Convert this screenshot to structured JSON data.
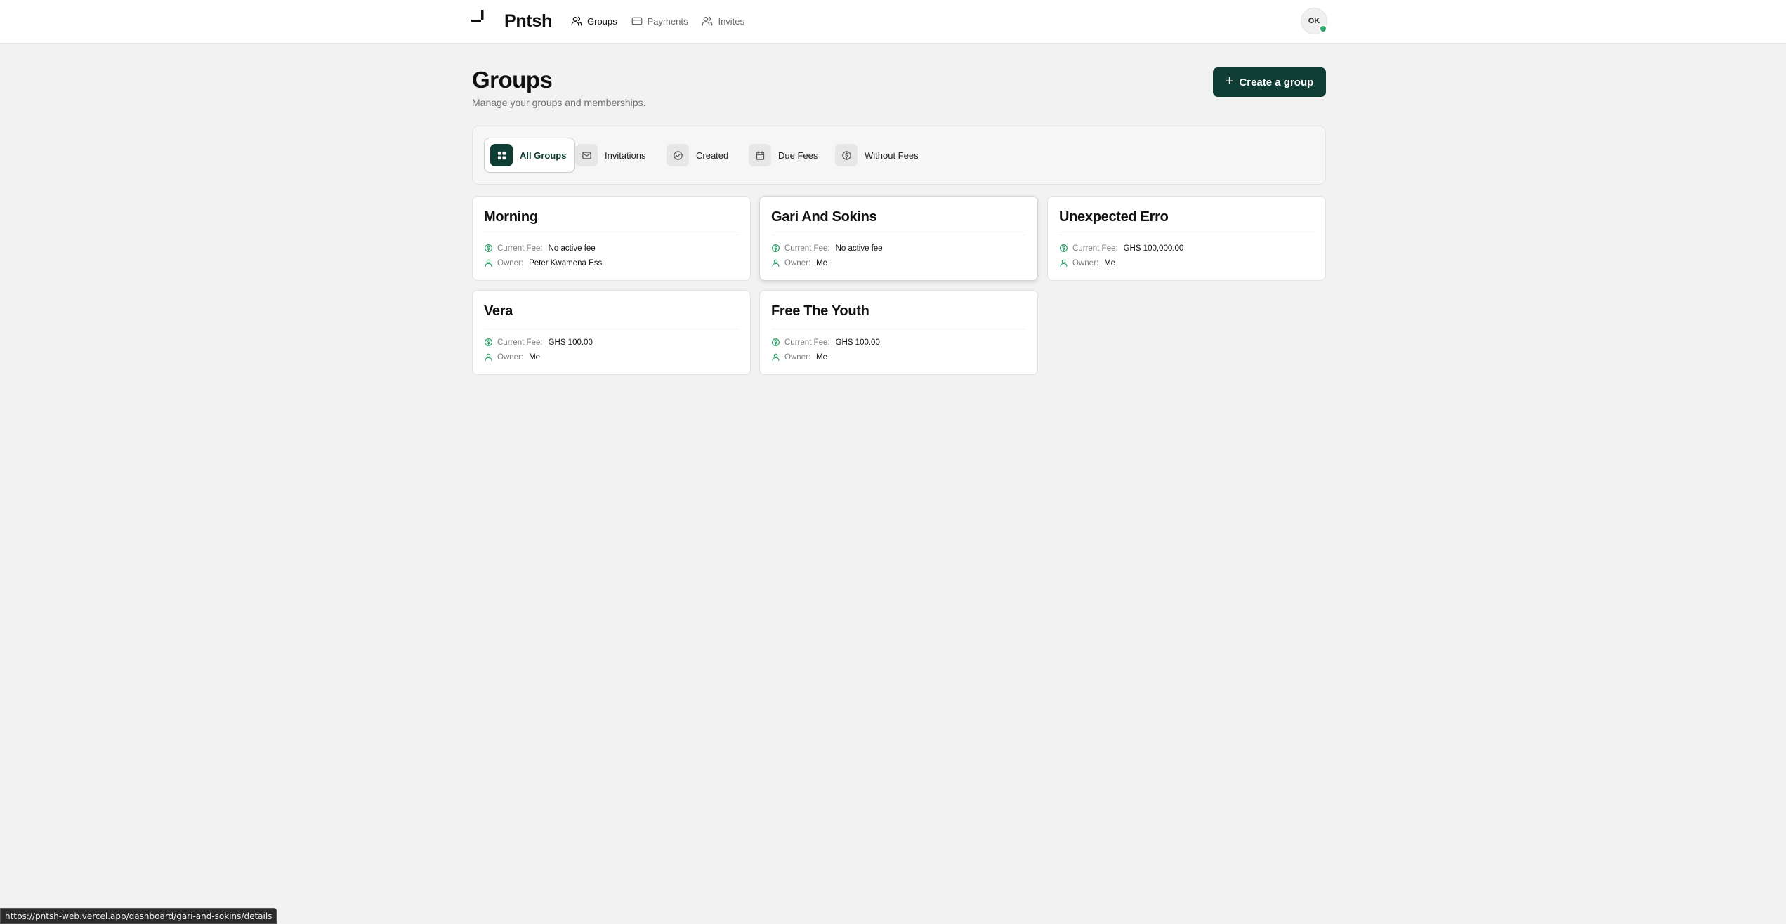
{
  "app": {
    "brand": "Pntsh"
  },
  "nav": {
    "items": [
      {
        "label": "Groups",
        "icon": "users-icon",
        "active": true
      },
      {
        "label": "Payments",
        "icon": "credit-card-icon",
        "active": false
      },
      {
        "label": "Invites",
        "icon": "user-icon",
        "active": false
      }
    ]
  },
  "user": {
    "initials": "OK",
    "online": true
  },
  "header": {
    "title": "Groups",
    "subtitle": "Manage your groups and memberships.",
    "create_label": "Create a group"
  },
  "filters": [
    {
      "label": "All Groups",
      "icon": "grid-icon",
      "active": true
    },
    {
      "label": "Invitations",
      "icon": "mail-icon",
      "active": false
    },
    {
      "label": "Created",
      "icon": "check-circle-icon",
      "active": false
    },
    {
      "label": "Due Fees",
      "icon": "calendar-icon",
      "active": false
    },
    {
      "label": "Without Fees",
      "icon": "dollar-circle-icon",
      "active": false
    }
  ],
  "card_labels": {
    "fee": "Current Fee:",
    "owner": "Owner:"
  },
  "groups": [
    {
      "name": "Morning",
      "fee": "No active fee",
      "owner": "Peter Kwamena Ess"
    },
    {
      "name": "Gari And Sokins",
      "fee": "No active fee",
      "owner": "Me"
    },
    {
      "name": "Unexpected Erro",
      "fee": "GHS 100,000.00",
      "owner": "Me"
    },
    {
      "name": "Vera",
      "fee": "GHS 100.00",
      "owner": "Me"
    },
    {
      "name": "Free The Youth",
      "fee": "GHS 100.00",
      "owner": "Me"
    }
  ],
  "status_bar": {
    "url": "https://pntsh-web.vercel.app/dashboard/gari-and-sokins/details"
  },
  "colors": {
    "accent": "#0f3d33",
    "icon_green": "#2fa36b",
    "background": "#f2f2f2"
  }
}
